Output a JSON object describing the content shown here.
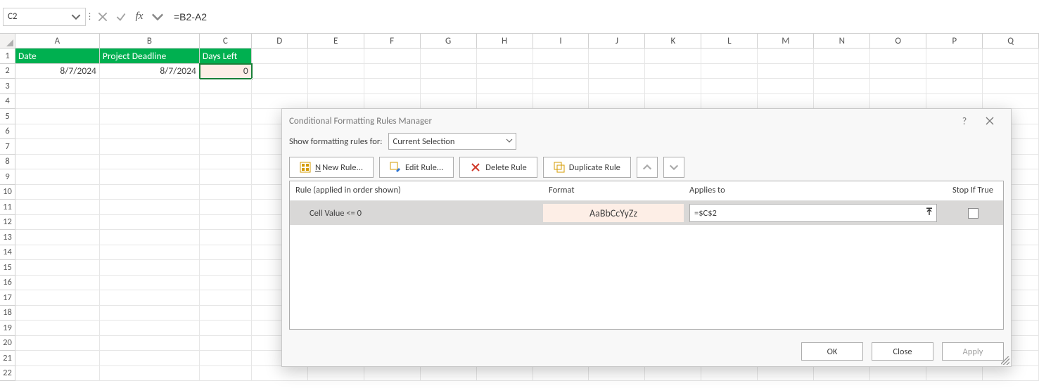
{
  "formula_bar": {
    "name_box": "C2",
    "formula": "=B2-A2"
  },
  "columns": [
    "A",
    "B",
    "C",
    "D",
    "E",
    "F",
    "G",
    "H",
    "I",
    "J",
    "K",
    "L",
    "M",
    "N",
    "O",
    "P",
    "Q"
  ],
  "rows": [
    "1",
    "2",
    "3",
    "4",
    "5",
    "6",
    "7",
    "8",
    "9",
    "10",
    "11",
    "12",
    "13",
    "14",
    "15",
    "16",
    "17",
    "18",
    "19",
    "20"
  ],
  "table": {
    "headers": {
      "A": "Date",
      "B": "Project Deadline",
      "C": "Days Left"
    },
    "row2": {
      "A": "8/7/2024",
      "B": "8/7/2024",
      "C": "0"
    }
  },
  "dialog": {
    "title": "Conditional Formatting Rules Manager",
    "show_label": "Show formatting rules for:",
    "show_value": "Current Selection",
    "buttons": {
      "new_rule": "New Rule...",
      "edit_rule": "Edit Rule...",
      "delete_rule": "Delete Rule",
      "duplicate_rule": "Duplicate Rule"
    },
    "columns": {
      "rule": "Rule (applied in order shown)",
      "format": "Format",
      "applies": "Applies to",
      "stop": "Stop If True"
    },
    "rule": {
      "desc": "Cell Value <= 0",
      "preview": "AaBbCcYyZz",
      "applies_to": "=$C$2"
    },
    "footer": {
      "ok": "OK",
      "close": "Close",
      "apply": "Apply"
    }
  }
}
